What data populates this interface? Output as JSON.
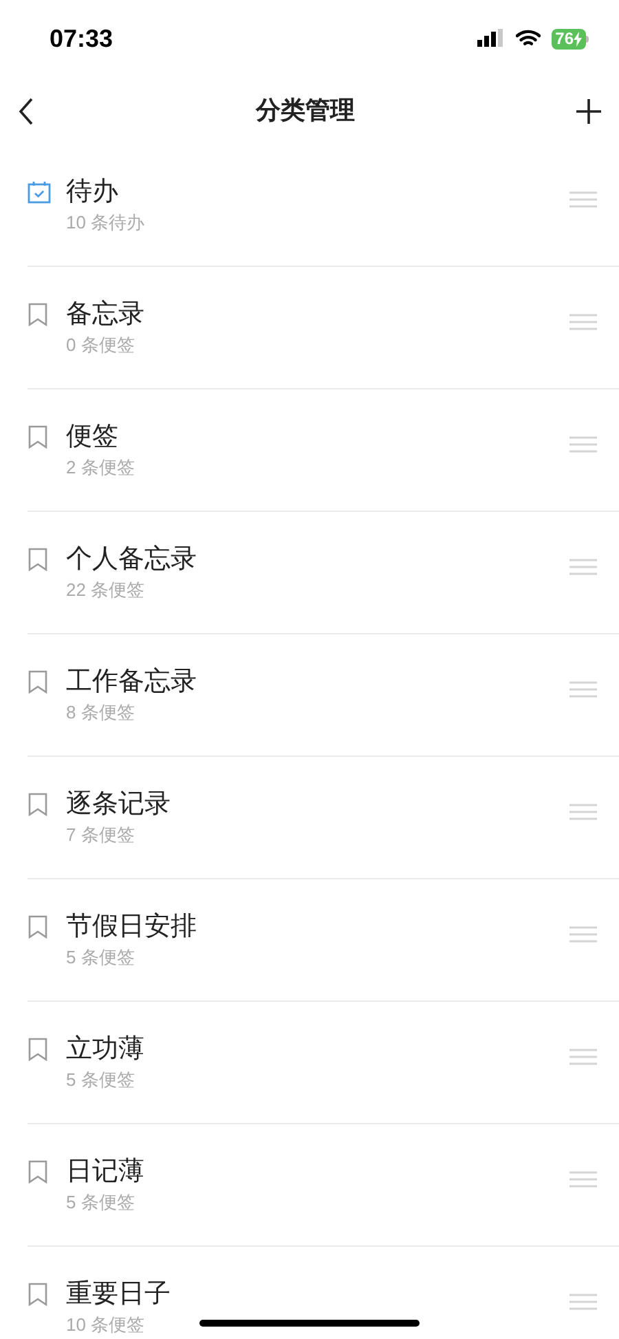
{
  "status_bar": {
    "time": "07:33",
    "battery": "76"
  },
  "nav": {
    "title": "分类管理"
  },
  "categories": [
    {
      "kind": "todo",
      "name": "待办",
      "count": "10 条待办"
    },
    {
      "kind": "note",
      "name": "备忘录",
      "count": "0 条便签"
    },
    {
      "kind": "note",
      "name": "便签",
      "count": "2 条便签"
    },
    {
      "kind": "note",
      "name": "个人备忘录",
      "count": "22 条便签"
    },
    {
      "kind": "note",
      "name": "工作备忘录",
      "count": "8 条便签"
    },
    {
      "kind": "note",
      "name": "逐条记录",
      "count": "7 条便签"
    },
    {
      "kind": "note",
      "name": "节假日安排",
      "count": "5 条便签"
    },
    {
      "kind": "note",
      "name": "立功薄",
      "count": "5 条便签"
    },
    {
      "kind": "note",
      "name": "日记薄",
      "count": "5 条便签"
    },
    {
      "kind": "note",
      "name": "重要日子",
      "count": "10 条便签"
    }
  ]
}
